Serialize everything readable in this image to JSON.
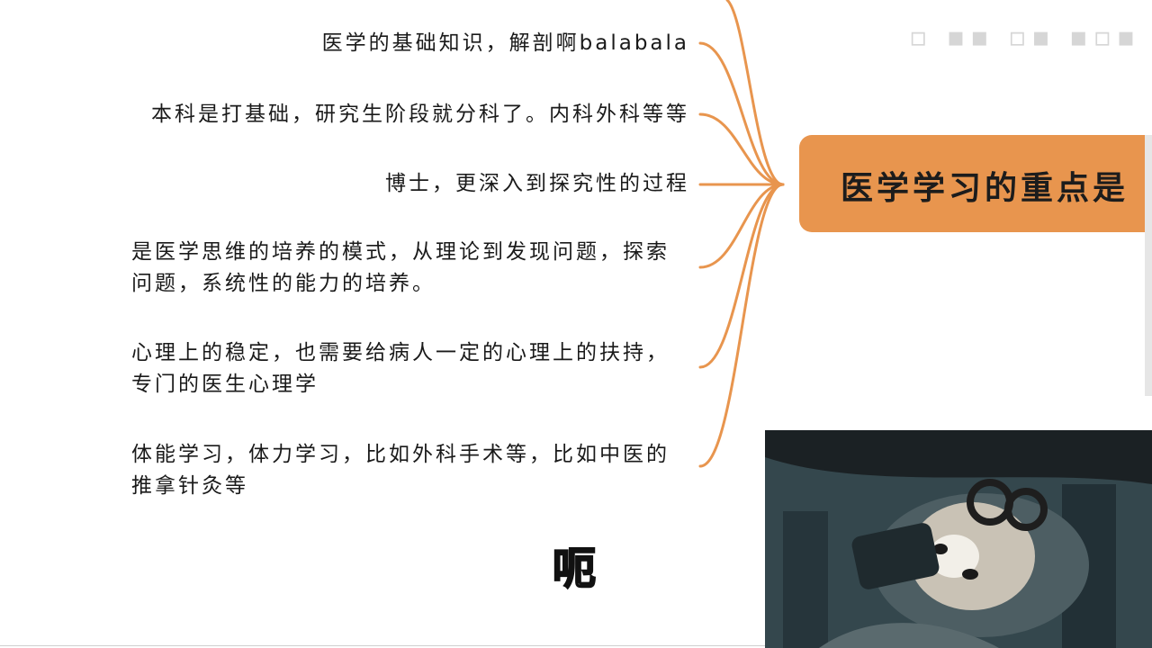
{
  "central_topic": "医学学习的重点是",
  "branches": [
    {
      "text": "医学的基础知识，解剖啊balabala"
    },
    {
      "text": "本科是打基础，研究生阶段就分科了。内科外科等等"
    },
    {
      "text": "博士，更深入到探究性的过程"
    },
    {
      "text": "是医学思维的培养的模式，从理论到发现问题，探索问题，系统性的能力的培养。"
    },
    {
      "text": "心理上的稳定，也需要给病人一定的心理上的扶持，专门的医生心理学"
    },
    {
      "text": "体能学习，体力学习，比如外科手术等，比如中医的推拿针灸等"
    }
  ],
  "subtitle": "呃",
  "colors": {
    "accent": "#e8954e",
    "connector": "#e8954e"
  }
}
